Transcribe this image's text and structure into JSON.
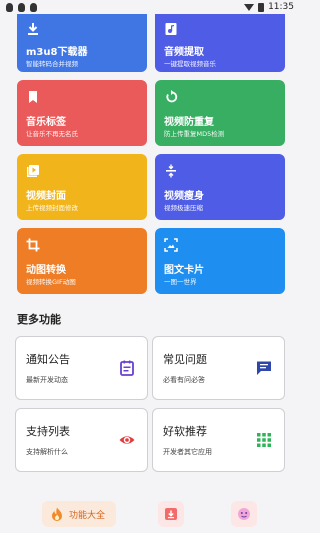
{
  "status_bar": {
    "time": "11:35"
  },
  "tiles": [
    {
      "title": "m3u8下载器",
      "subtitle": "智能转码合并视频",
      "icon": "download-icon",
      "color": "#3f76e4"
    },
    {
      "title": "音频提取",
      "subtitle": "一键提取视频音乐",
      "icon": "music-file-icon",
      "color": "#4f5ce6"
    },
    {
      "title": "音乐标签",
      "subtitle": "让音乐不再无名氏",
      "icon": "bookmark-icon",
      "color": "#eb5a5a"
    },
    {
      "title": "视频防重复",
      "subtitle": "防上传重复MD5检测",
      "icon": "refresh-icon",
      "color": "#37ae62"
    },
    {
      "title": "视频封面",
      "subtitle": "上传视频封面修改",
      "icon": "video-cover-icon",
      "color": "#f1b41b"
    },
    {
      "title": "视频瘦身",
      "subtitle": "视频极速压缩",
      "icon": "compress-icon",
      "color": "#4f5ce6"
    },
    {
      "title": "动图转换",
      "subtitle": "视频转换GIF动图",
      "icon": "crop-icon",
      "color": "#ee7d26"
    },
    {
      "title": "图文卡片",
      "subtitle": "一图一世界",
      "icon": "image-card-icon",
      "color": "#1f8ef1"
    }
  ],
  "section_title": "更多功能",
  "more_cards": [
    {
      "title": "通知公告",
      "subtitle": "最新开发动态",
      "icon": "notice-icon",
      "icon_color": "#6a3fd1"
    },
    {
      "title": "常见问题",
      "subtitle": "必看有问必答",
      "icon": "chat-icon",
      "icon_color": "#2f47a8"
    },
    {
      "title": "支持列表",
      "subtitle": "支持解析什么",
      "icon": "eye-icon",
      "icon_color": "#e23c3c"
    },
    {
      "title": "好软推荐",
      "subtitle": "开发者其它应用",
      "icon": "apps-grid-icon",
      "icon_color": "#2fb457"
    }
  ],
  "bottom_nav": {
    "active_label": "功能大全"
  }
}
